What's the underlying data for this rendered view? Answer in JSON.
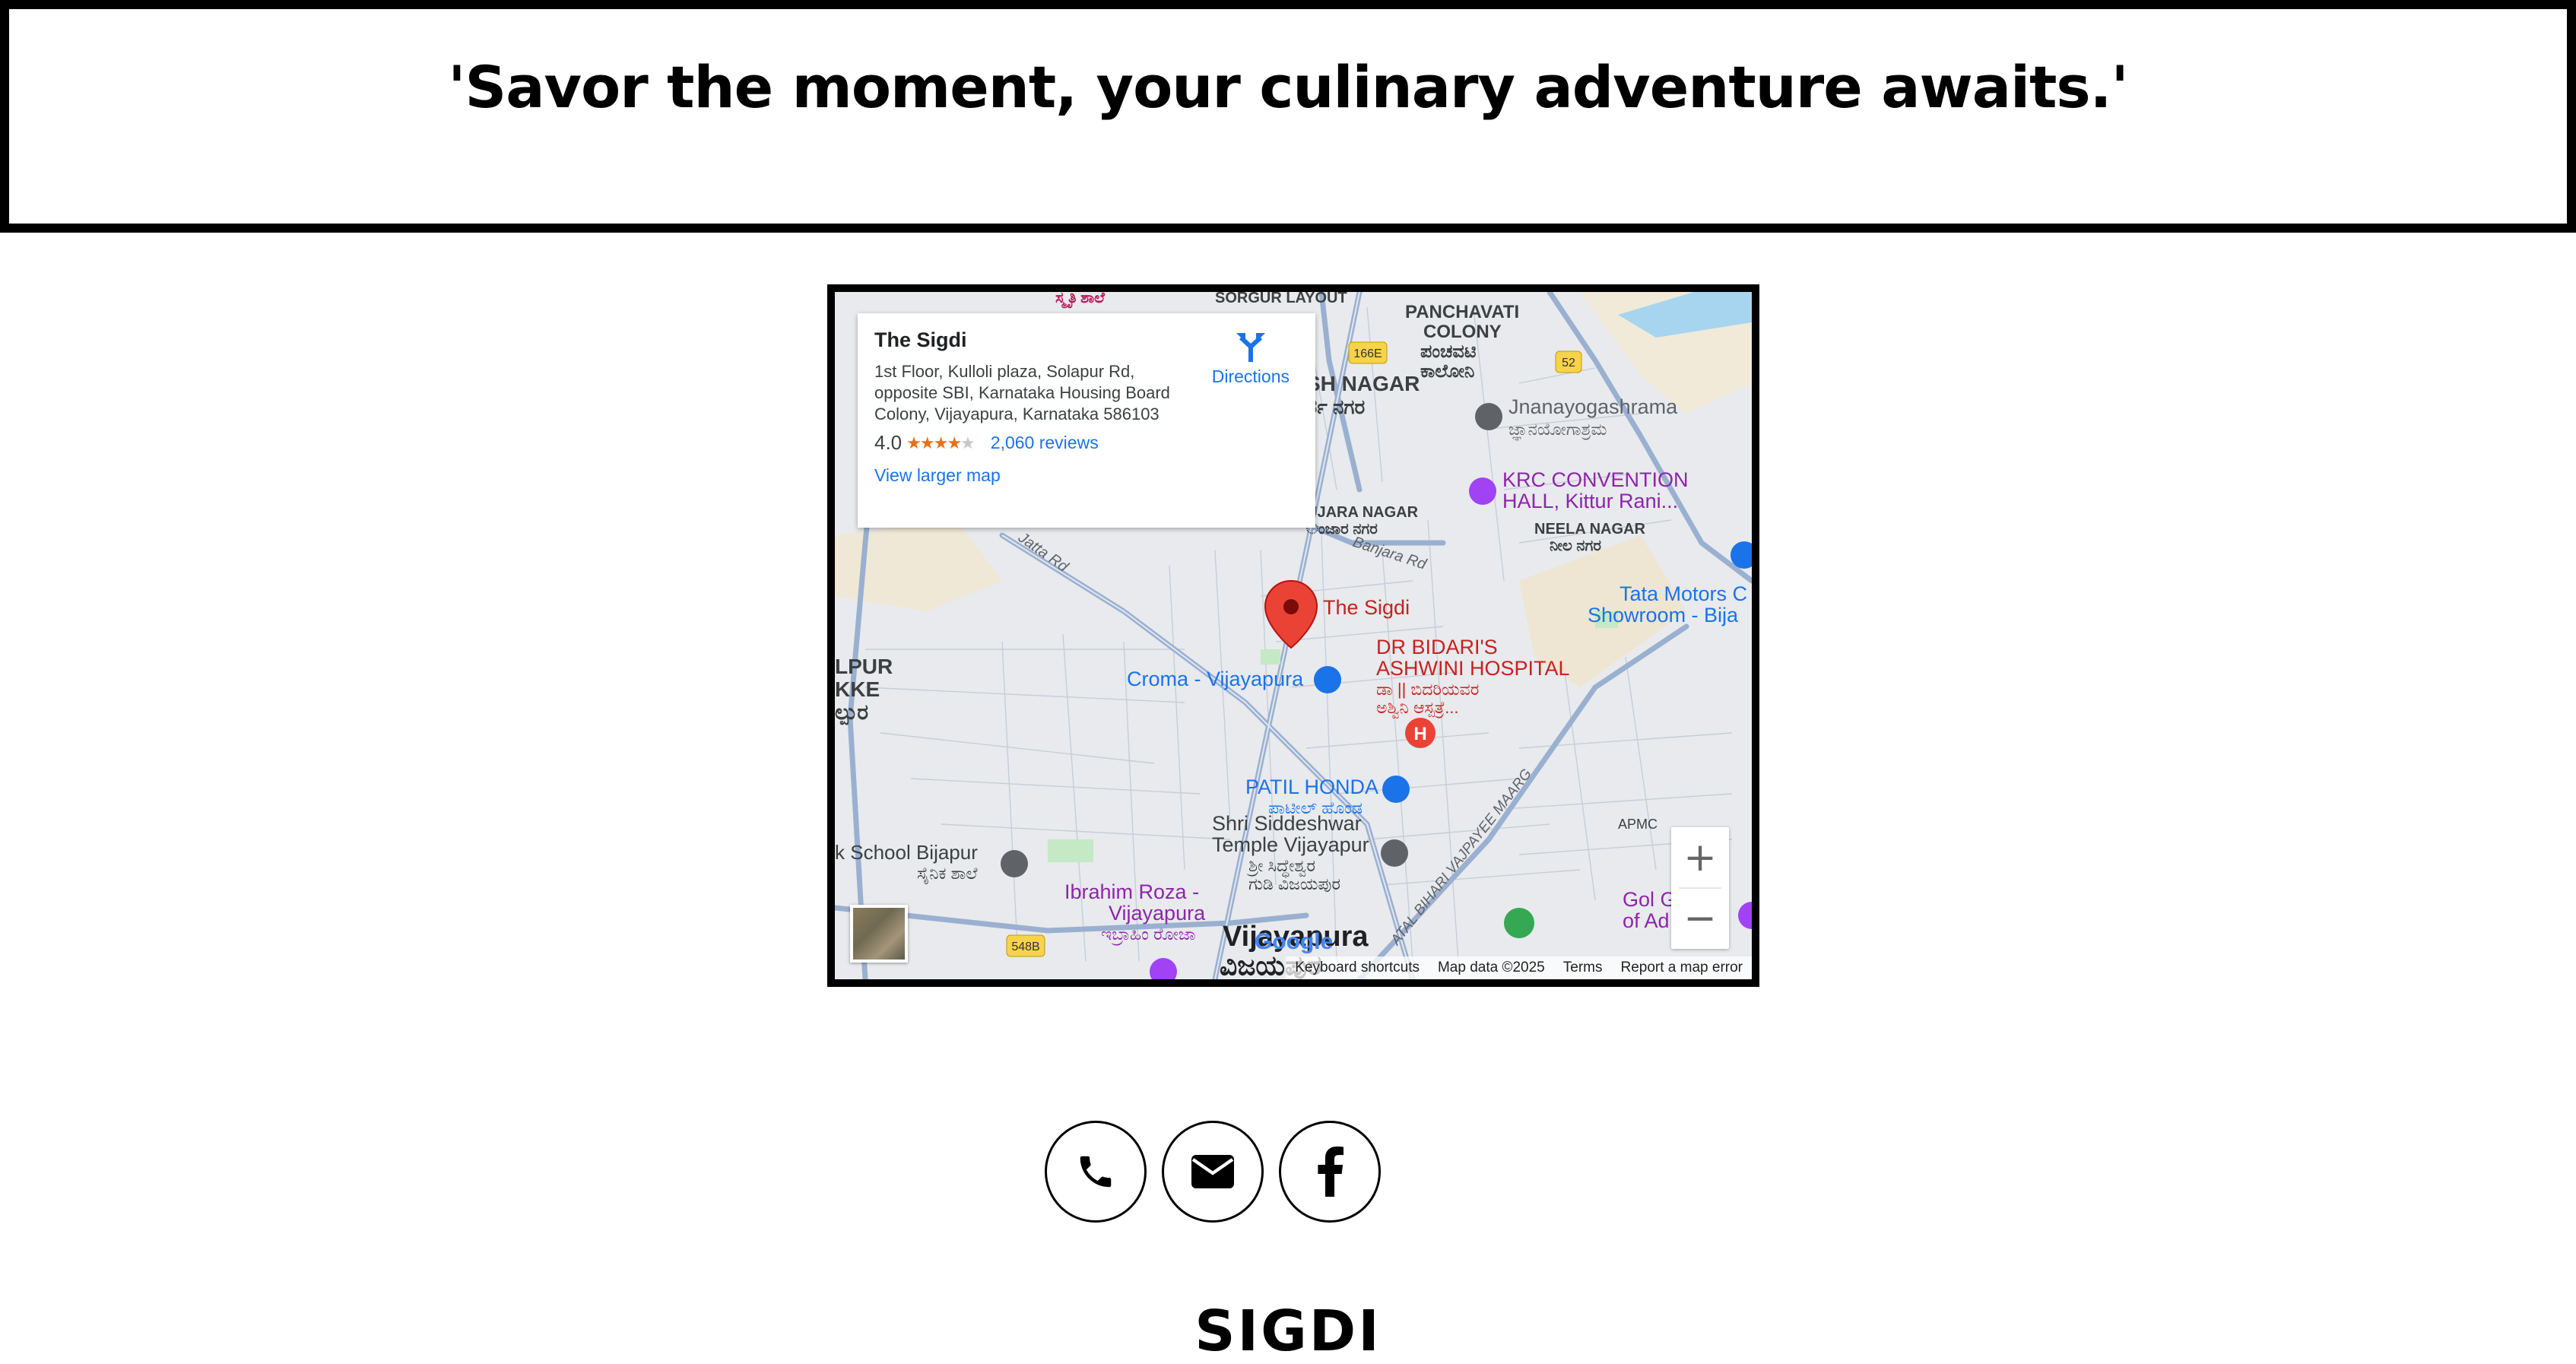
{
  "quote": "'Savor the moment, your culinary adventure awaits.'",
  "map": {
    "place": {
      "name": "The Sigdi",
      "address": "1st Floor, Kulloli plaza, Solapur Rd, opposite SBI, Karnataka Housing Board Colony, Vijayapura, Karnataka 586103",
      "rating": "4.0",
      "stars": "★★★★",
      "stars_empty": "★",
      "reviews": "2,060 reviews",
      "larger_map": "View larger map",
      "directions": "Directions"
    },
    "labels": {
      "pin_label": "The Sigdi",
      "panchavati": "PANCHAVATI",
      "colony": "COLONY",
      "panchavati_kn": "ಪಂಚವಟಿ",
      "colony_kn": "ಕಾಲೋನಿ",
      "sh_nagar": "SH NAGAR",
      "sh_nagar_kn": "ರ್ಶ ನಗರ",
      "jnanayogashrama": "Jnanayogashrama",
      "jnanayogashrama_kn": "ಜ್ಞಾನಯೋಗಾಶ್ರಮ",
      "krc_line1": "KRC CONVENTION",
      "krc_line2": "HALL, Kittur Rani...",
      "neela_nagar": "NEELA NAGAR",
      "neela_nagar_kn": "ನೀಲ ನಗರ",
      "ujara_nagar": "UJARA NAGAR",
      "ujara_nagar_kn": "ಂಜಾರ ನಗರ",
      "banjara_rd": "Banjara Rd",
      "jatta_rd": "Jatta Rd",
      "tata_line1": "Tata Motors C",
      "tata_line2": "Showroom - Bija",
      "dr_bidari_line1": "DR BIDARI'S",
      "dr_bidari_line2": "ASHWINI HOSPITAL",
      "dr_bidari_kn1": "ಡಾ || ಬಿದರಿಯವರ",
      "dr_bidari_kn2": "ಅಶ್ವಿನಿ ಆಸ್ಪತ್ರೆ...",
      "croma": "Croma - Vijayapura",
      "lpur": "LPUR",
      "kke": "KKE",
      "lpur_kn": "ಲ್ಪುರ",
      "patil_honda": "PATIL HONDA",
      "patil_honda_kn": "ಪಾಟೀಲ್ ಹೊಂಡ",
      "siddeshwar_line1": "Shri Siddeshwar",
      "siddeshwar_line2": "Temple Vijayapur",
      "siddeshwar_kn1": "ಶ್ರೀ ಸಿದ್ಧೇಶ್ವರ",
      "siddeshwar_kn2": "ಗುಡಿ ವಿಜಯಪುರ",
      "school": "k School Bijapur",
      "school_kn": "ಸೈನಿಕ ಶಾಲೆ",
      "ibrahim_line1": "Ibrahim Roza -",
      "ibrahim_line2": "Vijayapura",
      "ibrahim_kn": "ಇಬ್ರಾಹಿಂ ರೋಜಾ",
      "vijayapura": "Vijayapura",
      "vijayapura_kn": "ವಿಜಯಪುರ",
      "atal": "ATAL BIHARI VAJPAYEE MAARG",
      "gol_line1": "Gol Gu",
      "gol_line2": "of Ad",
      "apmc": "APMC",
      "top_kn": "ಸ್ಮೃತಿ ಶಾಲೆ",
      "top_en": "SORGUR LAYOUT",
      "shield_166e": "166E",
      "shield_52": "52",
      "shield_548b": "548B"
    },
    "zoom_in": "+",
    "zoom_out": "−",
    "google": "Google",
    "footer": {
      "shortcuts": "Keyboard shortcuts",
      "mapdata": "Map data ©2025",
      "terms": "Terms",
      "report": "Report a map error"
    }
  },
  "brand": "SIGDI",
  "colors": {
    "accent_link": "#1a73e8",
    "pin_red": "#ea4335",
    "hospital_red": "#c5221f",
    "poi_purple": "#8e24aa",
    "poi_blue": "#1a73e8",
    "road_blue": "#8ea9cc",
    "map_bg": "#e8eaed"
  }
}
